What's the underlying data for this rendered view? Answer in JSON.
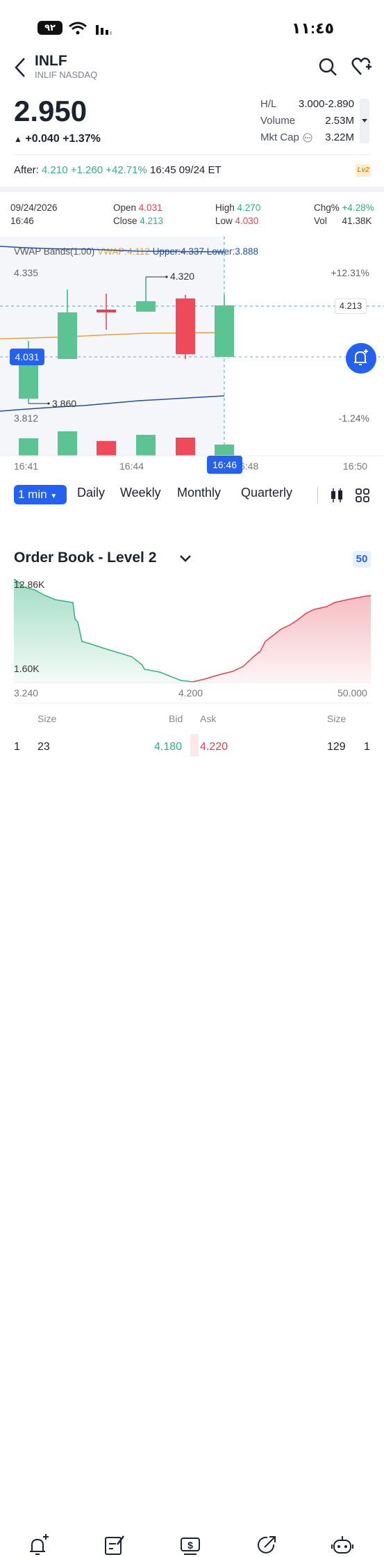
{
  "status": {
    "time": "١١:٤٥",
    "battery": "٩٢"
  },
  "header": {
    "symbol": "INLF",
    "exchange": "INLIF NASDAQ"
  },
  "quote": {
    "price": "2.950",
    "change": "+0.040",
    "change_pct": "+1.37%",
    "hl_label": "H/L",
    "hl_value": "3.000-2.890",
    "volume_label": "Volume",
    "volume_value": "2.53M",
    "mktcap_label": "Mkt Cap",
    "mktcap_value": "3.22M"
  },
  "after": {
    "label": "After:",
    "price": "4.210",
    "change": "+1.260",
    "change_pct": "+42.71%",
    "time": "16:45 09/24 ET",
    "badge": "Lv2"
  },
  "ohlc": {
    "date": "09/24/2026",
    "time": "16:46",
    "open_label": "Open",
    "open": "4.031",
    "close_label": "Close",
    "close": "4.213",
    "high_label": "High",
    "high": "4.270",
    "low_label": "Low",
    "low": "4.030",
    "chg_label": "Chg%",
    "chg": "+4.28%",
    "vol_label": "Vol",
    "vol": "41.38K"
  },
  "indicator": {
    "name": "VWAP Bands(1.00)",
    "vwap": "VWAP:4.112",
    "upper": "Upper:4.337",
    "lower": "Lower:3.888"
  },
  "chart_labels": {
    "top_left": "4.335",
    "bottom_left": "3.812",
    "top_right": "+12.31%",
    "bottom_right": "-1.24%",
    "hi_marker": "4.320",
    "lo_marker": "3.860",
    "cursor_price": "4.213",
    "open_tag": "4.031",
    "cursor_time": "16:46"
  },
  "x_axis": [
    "16:41",
    "16:44",
    "6:48",
    "16:50"
  ],
  "timeframes": {
    "active": "1 min",
    "items": [
      "Daily",
      "Weekly",
      "Monthly",
      "Quarterly"
    ]
  },
  "orderbook": {
    "title": "Order Book - Level 2",
    "badge": "50",
    "y_top": "12.86K",
    "y_bottom": "1.60K",
    "x_left": "3.240",
    "x_mid": "4.200",
    "x_right": "50.000",
    "col_size": "Size",
    "col_bid": "Bid",
    "col_ask": "Ask",
    "col_size2": "Size",
    "row": {
      "idx": "1",
      "bid_size": "23",
      "bid": "4.180",
      "ask": "4.220",
      "ask_size": "129",
      "idx2": "1"
    }
  },
  "colors": {
    "up": "#2fb37e",
    "down": "#e5414f",
    "accent": "#2461f0",
    "vwap": "#e5a23a",
    "band": "#1f4fa8"
  },
  "tabbar": [
    "alert-add-icon",
    "note-edit-icon",
    "trade-icon",
    "share-icon",
    "bot-icon"
  ]
}
